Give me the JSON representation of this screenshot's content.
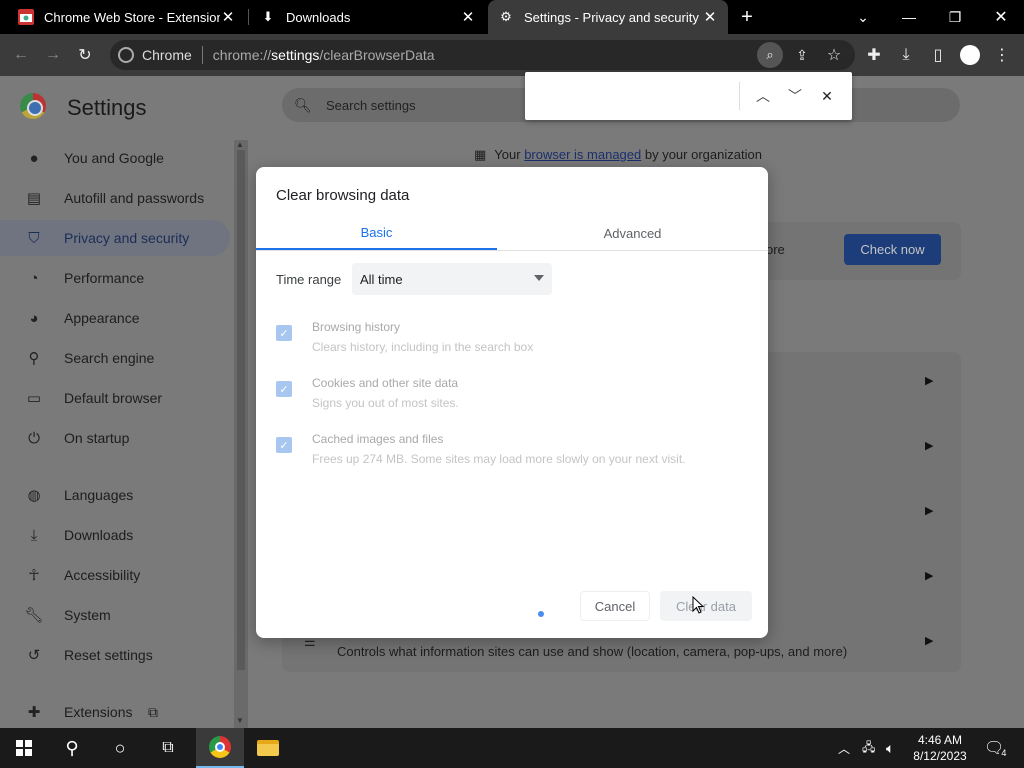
{
  "browser": {
    "tabs": [
      {
        "title": "Chrome Web Store - Extensions",
        "icon": "web-store-icon"
      },
      {
        "title": "Downloads",
        "icon": "download-icon"
      },
      {
        "title": "Settings - Privacy and security",
        "icon": "gear-icon"
      }
    ],
    "omnibox": {
      "chip": "Chrome",
      "url_prefix": "chrome://",
      "url_bold": "settings",
      "url_suffix": "/clearBrowserData"
    }
  },
  "settings": {
    "title": "Settings",
    "search_placeholder": "Search settings",
    "nav": [
      {
        "label": "You and Google",
        "icon": "person-icon"
      },
      {
        "label": "Autofill and passwords",
        "icon": "clipboard-icon"
      },
      {
        "label": "Privacy and security",
        "icon": "shield-icon"
      },
      {
        "label": "Performance",
        "icon": "speedometer-icon"
      },
      {
        "label": "Appearance",
        "icon": "palette-icon"
      },
      {
        "label": "Search engine",
        "icon": "search-icon"
      },
      {
        "label": "Default browser",
        "icon": "browser-icon"
      },
      {
        "label": "On startup",
        "icon": "power-icon"
      },
      {
        "label": "Languages",
        "icon": "globe-icon"
      },
      {
        "label": "Downloads",
        "icon": "download-icon"
      },
      {
        "label": "Accessibility",
        "icon": "accessibility-icon"
      },
      {
        "label": "System",
        "icon": "wrench-icon"
      },
      {
        "label": "Reset settings",
        "icon": "reset-icon"
      },
      {
        "label": "Extensions",
        "icon": "puzzle-icon"
      }
    ],
    "managed": {
      "prefix": "Your ",
      "link": "browser is managed",
      "suffix": " by your organization"
    },
    "safety_check_partial": "ore",
    "check_now": "Check now",
    "site_settings_desc": "Controls what information sites can use and show (location, camera, pop-ups, and more)"
  },
  "dialog": {
    "title": "Clear browsing data",
    "tabs": [
      "Basic",
      "Advanced"
    ],
    "time_range_label": "Time range",
    "time_range_value": "All time",
    "options": [
      {
        "title": "Browsing history",
        "desc": "Clears history, including in the search box",
        "checked": true
      },
      {
        "title": "Cookies and other site data",
        "desc": "Signs you out of most sites.",
        "checked": true
      },
      {
        "title": "Cached images and files",
        "desc": "Frees up 274 MB. Some sites may load more slowly on your next visit.",
        "checked": true
      }
    ],
    "cancel": "Cancel",
    "clear": "Clear data"
  },
  "taskbar": {
    "time": "4:46 AM",
    "date": "8/12/2023",
    "notifications": "4"
  }
}
